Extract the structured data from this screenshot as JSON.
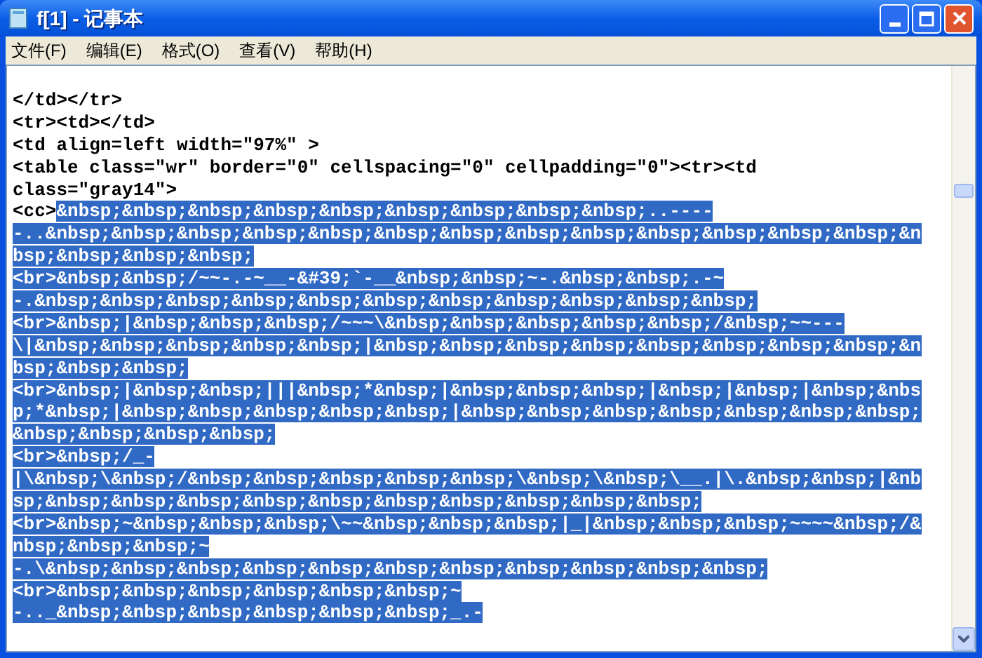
{
  "window": {
    "title": "f[1] - 记事本"
  },
  "menu": [
    "文件(F)",
    "编辑(E)",
    "格式(O)",
    "查看(V)",
    "帮助(H)"
  ],
  "lines": [
    [
      {
        "text": "</td></tr>",
        "selected": false
      }
    ],
    [
      {
        "text": "<tr><td></td>",
        "selected": false
      }
    ],
    [
      {
        "text": "<td align=left width=\"97%\" >",
        "selected": false
      }
    ],
    [
      {
        "text": "<table class=\"wr\" border=\"0\" cellspacing=\"0\" cellpadding=\"0\"><tr><td",
        "selected": false
      }
    ],
    [
      {
        "text": "class=\"gray14\">",
        "selected": false
      }
    ],
    [
      {
        "text": "<cc>",
        "selected": false
      },
      {
        "text": "&nbsp;&nbsp;&nbsp;&nbsp;&nbsp;&nbsp;&nbsp;&nbsp;&nbsp;..----",
        "selected": true
      }
    ],
    [
      {
        "text": "-..&nbsp;&nbsp;&nbsp;&nbsp;&nbsp;&nbsp;&nbsp;&nbsp;&nbsp;&nbsp;&nbsp;&nbsp;&nbsp;&n",
        "selected": true
      }
    ],
    [
      {
        "text": "bsp;&nbsp;&nbsp;&nbsp;",
        "selected": true
      }
    ],
    [
      {
        "text": "<br>&nbsp;&nbsp;/~~-.-~__-&#39;`-__&nbsp;&nbsp;~-.&nbsp;&nbsp;.-~",
        "selected": true
      }
    ],
    [
      {
        "text": "-.&nbsp;&nbsp;&nbsp;&nbsp;&nbsp;&nbsp;&nbsp;&nbsp;&nbsp;&nbsp;&nbsp;",
        "selected": true
      }
    ],
    [
      {
        "text": "<br>&nbsp;|&nbsp;&nbsp;&nbsp;/~~~\\&nbsp;&nbsp;&nbsp;&nbsp;&nbsp;/&nbsp;~~---",
        "selected": true
      }
    ],
    [
      {
        "text": "\\|&nbsp;&nbsp;&nbsp;&nbsp;&nbsp;|&nbsp;&nbsp;&nbsp;&nbsp;&nbsp;&nbsp;&nbsp;&nbsp;&n",
        "selected": true
      }
    ],
    [
      {
        "text": "bsp;&nbsp;&nbsp;",
        "selected": true
      }
    ],
    [
      {
        "text": "<br>&nbsp;|&nbsp;&nbsp;|||&nbsp;*&nbsp;|&nbsp;&nbsp;&nbsp;|&nbsp;|&nbsp;|&nbsp;&nbs",
        "selected": true
      }
    ],
    [
      {
        "text": "p;*&nbsp;|&nbsp;&nbsp;&nbsp;&nbsp;&nbsp;|&nbsp;&nbsp;&nbsp;&nbsp;&nbsp;&nbsp;&nbsp;",
        "selected": true
      }
    ],
    [
      {
        "text": "&nbsp;&nbsp;&nbsp;&nbsp;",
        "selected": true
      }
    ],
    [
      {
        "text": "<br>&nbsp;/_-",
        "selected": true
      }
    ],
    [
      {
        "text": "|\\&nbsp;\\&nbsp;/&nbsp;&nbsp;&nbsp;&nbsp;&nbsp;\\&nbsp;\\&nbsp;\\__.|\\.&nbsp;&nbsp;|&nb",
        "selected": true
      }
    ],
    [
      {
        "text": "sp;&nbsp;&nbsp;&nbsp;&nbsp;&nbsp;&nbsp;&nbsp;&nbsp;&nbsp;&nbsp;",
        "selected": true
      }
    ],
    [
      {
        "text": "<br>&nbsp;~&nbsp;&nbsp;&nbsp;\\~~&nbsp;&nbsp;&nbsp;|_|&nbsp;&nbsp;&nbsp;~~~~&nbsp;/&",
        "selected": true
      }
    ],
    [
      {
        "text": "nbsp;&nbsp;&nbsp;~",
        "selected": true
      }
    ],
    [
      {
        "text": "-.\\&nbsp;&nbsp;&nbsp;&nbsp;&nbsp;&nbsp;&nbsp;&nbsp;&nbsp;&nbsp;&nbsp;",
        "selected": true
      }
    ],
    [
      {
        "text": "<br>&nbsp;&nbsp;&nbsp;&nbsp;&nbsp;&nbsp;~",
        "selected": true
      }
    ],
    [
      {
        "text": "-.._&nbsp;&nbsp;&nbsp;&nbsp;&nbsp;&nbsp;_.-",
        "selected": true
      }
    ]
  ]
}
